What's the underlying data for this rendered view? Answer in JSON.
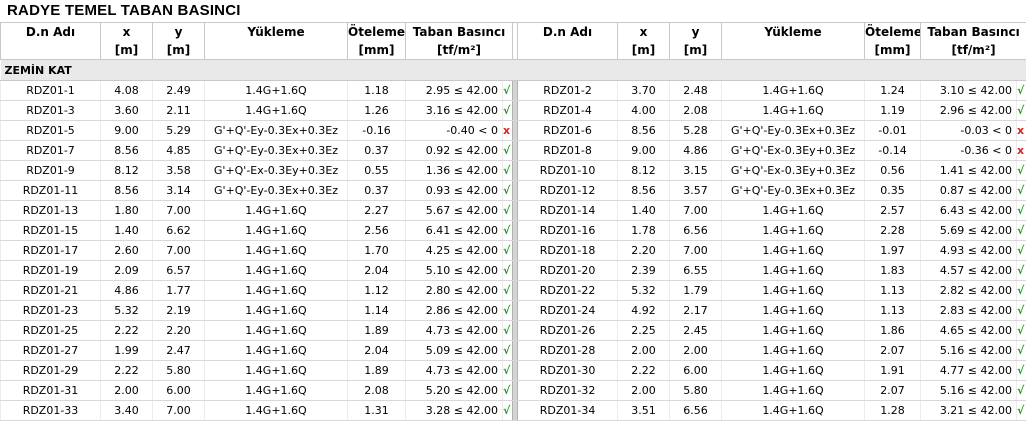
{
  "title": "RADYE TEMEL TABAN BASINCI",
  "headers": {
    "name": "D.n Adı",
    "x": "x",
    "x_unit": "[m]",
    "y": "y",
    "y_unit": "[m]",
    "load": "Yükleme",
    "disp": "Öteleme",
    "disp_unit": "[mm]",
    "press": "Taban Basıncı",
    "press_unit": "[tf/m²]"
  },
  "section": "ZEMİN KAT",
  "check_ok_symbol": "√",
  "check_fail_symbol": "x",
  "colors": {
    "ok": "#1a9c1a",
    "fail": "#e02020"
  },
  "rows": [
    {
      "left": {
        "name": "RDZ01-1",
        "x": "4.08",
        "y": "2.49",
        "load": "1.4G+1.6Q",
        "disp": "1.18",
        "press": "2.95 ≤ 42.00",
        "chk": "ok"
      },
      "right": {
        "name": "RDZ01-2",
        "x": "3.70",
        "y": "2.48",
        "load": "1.4G+1.6Q",
        "disp": "1.24",
        "press": "3.10 ≤ 42.00",
        "chk": "ok"
      }
    },
    {
      "left": {
        "name": "RDZ01-3",
        "x": "3.60",
        "y": "2.11",
        "load": "1.4G+1.6Q",
        "disp": "1.26",
        "press": "3.16 ≤ 42.00",
        "chk": "ok"
      },
      "right": {
        "name": "RDZ01-4",
        "x": "4.00",
        "y": "2.08",
        "load": "1.4G+1.6Q",
        "disp": "1.19",
        "press": "2.96 ≤ 42.00",
        "chk": "ok"
      }
    },
    {
      "left": {
        "name": "RDZ01-5",
        "x": "9.00",
        "y": "5.29",
        "load": "G'+Q'-Ey-0.3Ex+0.3Ez",
        "disp": "-0.16",
        "press": "-0.40 < 0",
        "chk": "fail"
      },
      "right": {
        "name": "RDZ01-6",
        "x": "8.56",
        "y": "5.28",
        "load": "G'+Q'-Ey-0.3Ex+0.3Ez",
        "disp": "-0.01",
        "press": "-0.03 < 0",
        "chk": "fail"
      }
    },
    {
      "left": {
        "name": "RDZ01-7",
        "x": "8.56",
        "y": "4.85",
        "load": "G'+Q'-Ey-0.3Ex+0.3Ez",
        "disp": "0.37",
        "press": "0.92 ≤ 42.00",
        "chk": "ok"
      },
      "right": {
        "name": "RDZ01-8",
        "x": "9.00",
        "y": "4.86",
        "load": "G'+Q'-Ex-0.3Ey+0.3Ez",
        "disp": "-0.14",
        "press": "-0.36 < 0",
        "chk": "fail"
      }
    },
    {
      "left": {
        "name": "RDZ01-9",
        "x": "8.12",
        "y": "3.58",
        "load": "G'+Q'-Ex-0.3Ey+0.3Ez",
        "disp": "0.55",
        "press": "1.36 ≤ 42.00",
        "chk": "ok"
      },
      "right": {
        "name": "RDZ01-10",
        "x": "8.12",
        "y": "3.15",
        "load": "G'+Q'-Ex-0.3Ey+0.3Ez",
        "disp": "0.56",
        "press": "1.41 ≤ 42.00",
        "chk": "ok"
      }
    },
    {
      "left": {
        "name": "RDZ01-11",
        "x": "8.56",
        "y": "3.14",
        "load": "G'+Q'-Ey-0.3Ex+0.3Ez",
        "disp": "0.37",
        "press": "0.93 ≤ 42.00",
        "chk": "ok"
      },
      "right": {
        "name": "RDZ01-12",
        "x": "8.56",
        "y": "3.57",
        "load": "G'+Q'-Ey-0.3Ex+0.3Ez",
        "disp": "0.35",
        "press": "0.87 ≤ 42.00",
        "chk": "ok"
      }
    },
    {
      "left": {
        "name": "RDZ01-13",
        "x": "1.80",
        "y": "7.00",
        "load": "1.4G+1.6Q",
        "disp": "2.27",
        "press": "5.67 ≤ 42.00",
        "chk": "ok"
      },
      "right": {
        "name": "RDZ01-14",
        "x": "1.40",
        "y": "7.00",
        "load": "1.4G+1.6Q",
        "disp": "2.57",
        "press": "6.43 ≤ 42.00",
        "chk": "ok"
      }
    },
    {
      "left": {
        "name": "RDZ01-15",
        "x": "1.40",
        "y": "6.62",
        "load": "1.4G+1.6Q",
        "disp": "2.56",
        "press": "6.41 ≤ 42.00",
        "chk": "ok"
      },
      "right": {
        "name": "RDZ01-16",
        "x": "1.78",
        "y": "6.56",
        "load": "1.4G+1.6Q",
        "disp": "2.28",
        "press": "5.69 ≤ 42.00",
        "chk": "ok"
      }
    },
    {
      "left": {
        "name": "RDZ01-17",
        "x": "2.60",
        "y": "7.00",
        "load": "1.4G+1.6Q",
        "disp": "1.70",
        "press": "4.25 ≤ 42.00",
        "chk": "ok"
      },
      "right": {
        "name": "RDZ01-18",
        "x": "2.20",
        "y": "7.00",
        "load": "1.4G+1.6Q",
        "disp": "1.97",
        "press": "4.93 ≤ 42.00",
        "chk": "ok"
      }
    },
    {
      "left": {
        "name": "RDZ01-19",
        "x": "2.09",
        "y": "6.57",
        "load": "1.4G+1.6Q",
        "disp": "2.04",
        "press": "5.10 ≤ 42.00",
        "chk": "ok"
      },
      "right": {
        "name": "RDZ01-20",
        "x": "2.39",
        "y": "6.55",
        "load": "1.4G+1.6Q",
        "disp": "1.83",
        "press": "4.57 ≤ 42.00",
        "chk": "ok"
      }
    },
    {
      "left": {
        "name": "RDZ01-21",
        "x": "4.86",
        "y": "1.77",
        "load": "1.4G+1.6Q",
        "disp": "1.12",
        "press": "2.80 ≤ 42.00",
        "chk": "ok"
      },
      "right": {
        "name": "RDZ01-22",
        "x": "5.32",
        "y": "1.79",
        "load": "1.4G+1.6Q",
        "disp": "1.13",
        "press": "2.82 ≤ 42.00",
        "chk": "ok"
      }
    },
    {
      "left": {
        "name": "RDZ01-23",
        "x": "5.32",
        "y": "2.19",
        "load": "1.4G+1.6Q",
        "disp": "1.14",
        "press": "2.86 ≤ 42.00",
        "chk": "ok"
      },
      "right": {
        "name": "RDZ01-24",
        "x": "4.92",
        "y": "2.17",
        "load": "1.4G+1.6Q",
        "disp": "1.13",
        "press": "2.83 ≤ 42.00",
        "chk": "ok"
      }
    },
    {
      "left": {
        "name": "RDZ01-25",
        "x": "2.22",
        "y": "2.20",
        "load": "1.4G+1.6Q",
        "disp": "1.89",
        "press": "4.73 ≤ 42.00",
        "chk": "ok"
      },
      "right": {
        "name": "RDZ01-26",
        "x": "2.25",
        "y": "2.45",
        "load": "1.4G+1.6Q",
        "disp": "1.86",
        "press": "4.65 ≤ 42.00",
        "chk": "ok"
      }
    },
    {
      "left": {
        "name": "RDZ01-27",
        "x": "1.99",
        "y": "2.47",
        "load": "1.4G+1.6Q",
        "disp": "2.04",
        "press": "5.09 ≤ 42.00",
        "chk": "ok"
      },
      "right": {
        "name": "RDZ01-28",
        "x": "2.00",
        "y": "2.00",
        "load": "1.4G+1.6Q",
        "disp": "2.07",
        "press": "5.16 ≤ 42.00",
        "chk": "ok"
      }
    },
    {
      "left": {
        "name": "RDZ01-29",
        "x": "2.22",
        "y": "5.80",
        "load": "1.4G+1.6Q",
        "disp": "1.89",
        "press": "4.73 ≤ 42.00",
        "chk": "ok"
      },
      "right": {
        "name": "RDZ01-30",
        "x": "2.22",
        "y": "6.00",
        "load": "1.4G+1.6Q",
        "disp": "1.91",
        "press": "4.77 ≤ 42.00",
        "chk": "ok"
      }
    },
    {
      "left": {
        "name": "RDZ01-31",
        "x": "2.00",
        "y": "6.00",
        "load": "1.4G+1.6Q",
        "disp": "2.08",
        "press": "5.20 ≤ 42.00",
        "chk": "ok"
      },
      "right": {
        "name": "RDZ01-32",
        "x": "2.00",
        "y": "5.80",
        "load": "1.4G+1.6Q",
        "disp": "2.07",
        "press": "5.16 ≤ 42.00",
        "chk": "ok"
      }
    },
    {
      "left": {
        "name": "RDZ01-33",
        "x": "3.40",
        "y": "7.00",
        "load": "1.4G+1.6Q",
        "disp": "1.31",
        "press": "3.28 ≤ 42.00",
        "chk": "ok"
      },
      "right": {
        "name": "RDZ01-34",
        "x": "3.51",
        "y": "6.56",
        "load": "1.4G+1.6Q",
        "disp": "1.28",
        "press": "3.21 ≤ 42.00",
        "chk": "ok"
      }
    }
  ]
}
